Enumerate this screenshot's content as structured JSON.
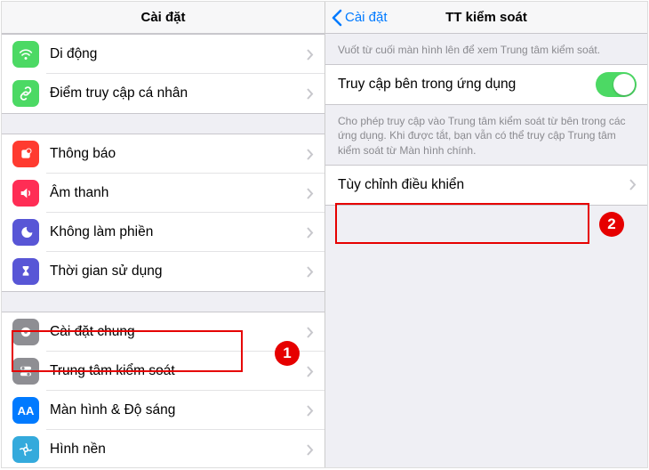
{
  "left": {
    "title": "Cài đặt",
    "rows0": [
      {
        "label": "Di động",
        "icon": "antenna",
        "color": "#4cd964"
      },
      {
        "label": "Điểm truy cập cá nhân",
        "icon": "link",
        "color": "#4cd964"
      }
    ],
    "rows1": [
      {
        "label": "Thông báo",
        "icon": "bell",
        "color": "#ff3b30"
      },
      {
        "label": "Âm thanh",
        "icon": "sound",
        "color": "#ff2d55"
      },
      {
        "label": "Không làm phiền",
        "icon": "moon",
        "color": "#5856d6"
      },
      {
        "label": "Thời gian sử dụng",
        "icon": "hourglass",
        "color": "#5856d6"
      }
    ],
    "rows2": [
      {
        "label": "Cài đặt chung",
        "icon": "gear",
        "color": "#8e8e93"
      },
      {
        "label": "Trung tâm kiểm soát",
        "icon": "controls",
        "color": "#8e8e93"
      },
      {
        "label": "Màn hình & Độ sáng",
        "icon": "aa",
        "color": "#007aff"
      },
      {
        "label": "Hình nền",
        "icon": "wallpaper",
        "color": "#34aadc"
      }
    ],
    "callout": "1"
  },
  "right": {
    "back": "Cài đặt",
    "title": "TT kiểm soát",
    "note0": "Vuốt từ cuối màn hình lên để xem Trung tâm kiểm soát.",
    "toggle_label": "Truy cập bên trong ứng dụng",
    "note1": "Cho phép truy cập vào Trung tâm kiểm soát từ bên trong các ứng dụng. Khi được tắt, bạn vẫn có thể truy cập Trung tâm kiểm soát từ Màn hình chính.",
    "customize": "Tùy chỉnh điều khiển",
    "callout": "2"
  }
}
